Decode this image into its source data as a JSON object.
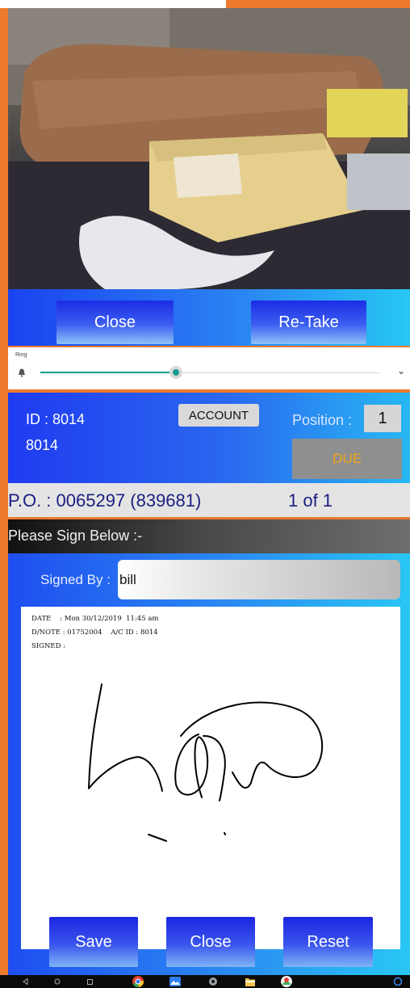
{
  "camera": {
    "close_label": "Close",
    "retake_label": "Re-Take"
  },
  "ring": {
    "label": "Ring",
    "level_fraction": 0.4
  },
  "delivery": {
    "id_text": "ID : 8014",
    "id_sub": "8014",
    "account_label": "ACCOUNT",
    "position_label": "Position :",
    "position_value": "1",
    "status_label": "DUE"
  },
  "po": {
    "number_text": "P.O. : 0065297 (839681)",
    "count_text": "1  of  1"
  },
  "sign": {
    "header": "Please Sign Below :-",
    "signed_by_label": "Signed By :",
    "signed_by_value": "bill",
    "meta": {
      "date_line": "DATE    : Mon 30/12/2019  11:45 am",
      "dnote_line": "D/NOTE : 01752004    A/C ID : 8014",
      "signed_line": "SIGNED :"
    }
  },
  "actions": {
    "save_label": "Save",
    "close_label": "Close",
    "reset_label": "Reset"
  },
  "navbar": {
    "icons": [
      "back-icon",
      "home-icon",
      "recents-icon",
      "chrome-icon",
      "gallery-icon",
      "settings-icon",
      "files-icon",
      "maps-icon",
      "assistant-icon"
    ]
  },
  "colors": {
    "accent_orange": "#ee7a2e",
    "due_text": "#f2a516",
    "po_text": "#1b1e82",
    "slider_teal": "#179c8d"
  }
}
